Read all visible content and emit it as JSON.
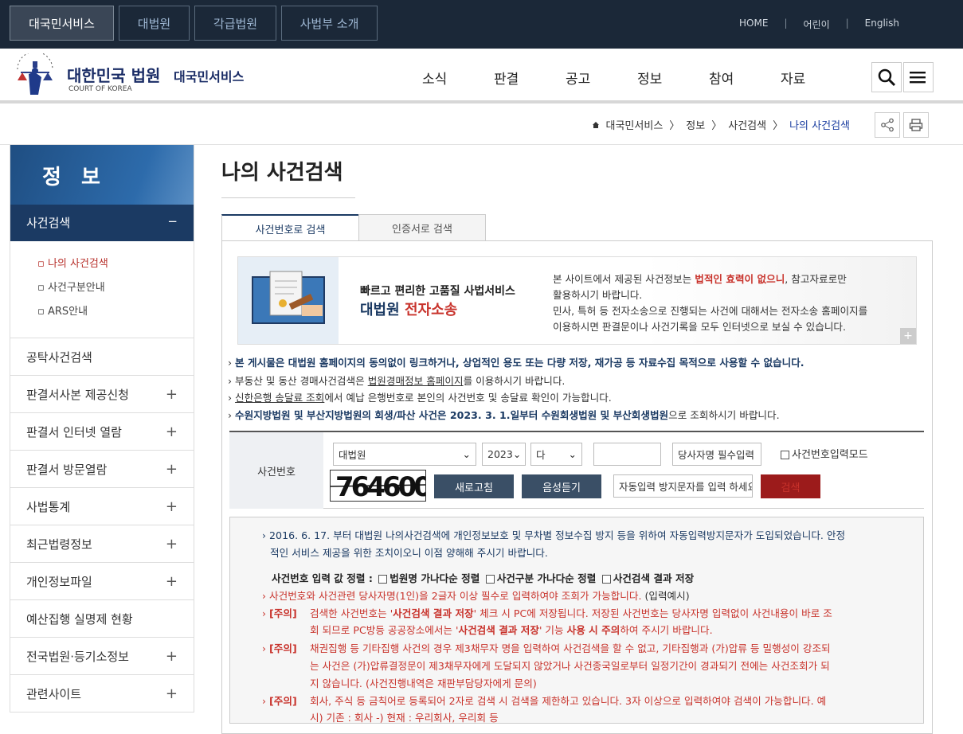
{
  "topnav": {
    "tabs": [
      "대국민서비스",
      "대법원",
      "각급법원",
      "사법부 소개"
    ],
    "links": [
      "HOME",
      "어린이",
      "English"
    ]
  },
  "header": {
    "logo_title": "대한민국 법원",
    "logo_sub": "COURT OF KOREA",
    "service_name": "대국민서비스",
    "gnb": [
      "소식",
      "판결",
      "공고",
      "정보",
      "참여",
      "자료"
    ]
  },
  "breadcrumb": [
    "대국민서비스",
    "정보",
    "사건검색",
    "나의 사건검색"
  ],
  "sidebar": {
    "title": "정 보",
    "active": "사건검색",
    "active_sign": "−",
    "sub": [
      "나의 사건검색",
      "사건구분안내",
      "ARS안내"
    ],
    "items": [
      {
        "label": "공탁사건검색",
        "plus": ""
      },
      {
        "label": "판결서사본 제공신청",
        "plus": "+"
      },
      {
        "label": "판결서 인터넷 열람",
        "plus": "+"
      },
      {
        "label": "판결서 방문열람",
        "plus": "+"
      },
      {
        "label": "사법통계",
        "plus": "+"
      },
      {
        "label": "최근법령정보",
        "plus": "+"
      },
      {
        "label": "개인정보파일",
        "plus": "+"
      },
      {
        "label": "예산집행 실명제 현황",
        "plus": ""
      },
      {
        "label": "전국법원·등기소정보",
        "plus": "+"
      },
      {
        "label": "관련사이트",
        "plus": "+"
      }
    ]
  },
  "page": {
    "title": "나의 사건검색",
    "tabs": [
      "사건번호로 검색",
      "인증서로 검색"
    ]
  },
  "banner": {
    "line1": "빠르고 편리한 고품질 사법서비스",
    "line2a": "대법원 ",
    "line2b": "전자소송",
    "desc1a": "본 사이트에서 제공된 사건정보는 ",
    "desc1b": "법적인 효력이 없으니",
    "desc1c": ", 참고자료로만",
    "desc2": "활용하시기 바랍니다.",
    "desc3": "민사, 특허 등 전자소송으로 진행되는 사건에 대해서는 전자소송 홈페이지를",
    "desc4": "이용하시면 판결문이나 사건기록을 모두 인터넷으로 보실 수 있습니다.",
    "plus": "+"
  },
  "notices": {
    "n1": "본 게시물은 대법원 홈페이지의 동의없이 링크하거나, 상업적인 용도 또는 다량 저장, 재가공 등 자료수집 목적으로 사용할 수 없습니다.",
    "n2a": "부동산 및 동산 경매사건검색은 ",
    "n2b": "법원경매정보 홈페이지",
    "n2c": "를 이용하시기 바랍니다.",
    "n3a": "신한은행 송달료 조회",
    "n3b": "에서 예납 은행번호로 본인의 사건번호 및 송달료 확인이 가능합니다.",
    "n4a": "수원지방법원 및 부산지방법원의 회생/파산 사건은 2023. 3. 1.일부터 수원회생법원 및 부산회생법원",
    "n4b": "으로 조회하시기 바랍니다."
  },
  "search": {
    "label": "사건번호",
    "court": "대법원",
    "year": "2023",
    "type": "다",
    "number": "",
    "party_placeholder": "당사자명 필수입력",
    "mode_label": "사건번호입력모드",
    "captcha": "764600",
    "refresh": "새로고침",
    "audio": "음성듣기",
    "captcha_placeholder": "자동입력 방지문자를 입력 하세요.",
    "submit": "검색"
  },
  "info": {
    "l1": "2016. 6. 17. 부터 대법원 나의사건검색에 개인정보보호 및 무차별 정보수집 방지 등을 위하여 자동입력방지문자가 도입되었습니다. 안정",
    "l2": "적인 서비스 제공을 위한 조치이오니 이점 양해해 주시기 바랍니다.",
    "sort_label": "사건번호 입력 값 정렬 :",
    "sort1": "법원명 가나다순 정렬",
    "sort2": "사건구분 가나다순 정렬",
    "sort3": "사건검색 결과 저장",
    "r1a": "사건번호와 사건관련 당사자명(1인)을 2글자 이상 필수로 입력하여야 조회가 가능합니다.",
    "r1b": " (입력예시)",
    "tag": "[주의]",
    "c1a": "검색한 사건번호는 '",
    "c1b": "사건검색 결과 저장",
    "c1c": "' 체크 시 PC에 저장됩니다. 저장된 사건번호는 당사자명 입력없이 사건내용이 바로 조",
    "c1d": "회 되므로 PC방등 공공장소에서는 '",
    "c1e": "사건검색 결과 저장",
    "c1f": "' 기능 ",
    "c1g": "사용 시 주의",
    "c1h": "하여 주시기 바랍니다.",
    "c2a": "채권집행 등 기타집행 사건의 경우 제3채무자 명을 입력하여 사건검색을 할 수 없고, 기타집행과 (가)압류 등 밀행성이 강조되",
    "c2b": "는 사건은 (가)압류결정문이 제3채무자에게 도달되지 않았거나 사건종국일로부터 일정기간이 경과되기 전에는 사건조회가 되",
    "c2c": "지 않습니다. (사건진행내역은 재판부담당자에게 문의)",
    "c3a": "회사, 주식 등 금칙어로 등록되어 2자로 검색 시 검색을 제한하고 있습니다. 3자 이상으로 입력하여야 검색이 가능합니다. 예",
    "c3b": "시) 기존 : 회사 -) 현재 : 우리회사, 우리회 등"
  }
}
